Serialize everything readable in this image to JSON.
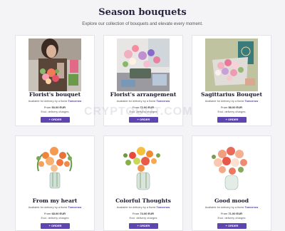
{
  "page": {
    "title": "Season bouquets",
    "subtitle": "Explore our collection of bouquets and elevate every moment."
  },
  "watermark": "CRYPTOOUT.COM",
  "colors": {
    "accent": "#5f45b0",
    "title": "#2b2440"
  },
  "cards": [
    {
      "name": "Florist's bouquet",
      "avail_prefix": "Available for delivery by a florist",
      "avail_when": "Tomorrow",
      "price_prefix": "From",
      "price": "53.00 EUR",
      "excl": "Excl. delivery charges",
      "order_label": "+ ORDER",
      "image": "florist-holding-bouquet"
    },
    {
      "name": "Florist's arrangement",
      "avail_prefix": "Available for delivery by a florist",
      "avail_when": "Tomorrow",
      "price_prefix": "From",
      "price": "72.00 EUR",
      "excl": "Excl. delivery charges",
      "order_label": "+ ORDER",
      "image": "flower-arrangement"
    },
    {
      "name": "Sagittarius Bouquet",
      "avail_prefix": "Available for delivery by a florist",
      "avail_when": "Tomorrow",
      "price_prefix": "From",
      "price": "58.00 EUR",
      "excl": "Excl. delivery charges",
      "order_label": "+ ORDER",
      "image": "wrapped-bouquet"
    },
    {
      "name": "From my heart",
      "avail_prefix": "Available for delivery by a florist",
      "avail_when": "Tomorrow",
      "price_prefix": "From",
      "price": "68.00 EUR",
      "excl": "Excl. delivery charges",
      "order_label": "+ ORDER",
      "image": "orange-bouquet-vase"
    },
    {
      "name": "Colorful Thoughts",
      "avail_prefix": "Available for delivery by a florist",
      "avail_when": "Tomorrow",
      "price_prefix": "From",
      "price": "74.00 EUR",
      "excl": "Excl. delivery charges",
      "order_label": "+ ORDER",
      "image": "mixed-bouquet-vase"
    },
    {
      "name": "Good mood",
      "avail_prefix": "Available for delivery by a florist",
      "avail_when": "Tomorrow",
      "price_prefix": "From",
      "price": "71.00 EUR",
      "excl": "Excl. delivery charges",
      "order_label": "+ ORDER",
      "image": "peach-bouquet-vase"
    }
  ]
}
